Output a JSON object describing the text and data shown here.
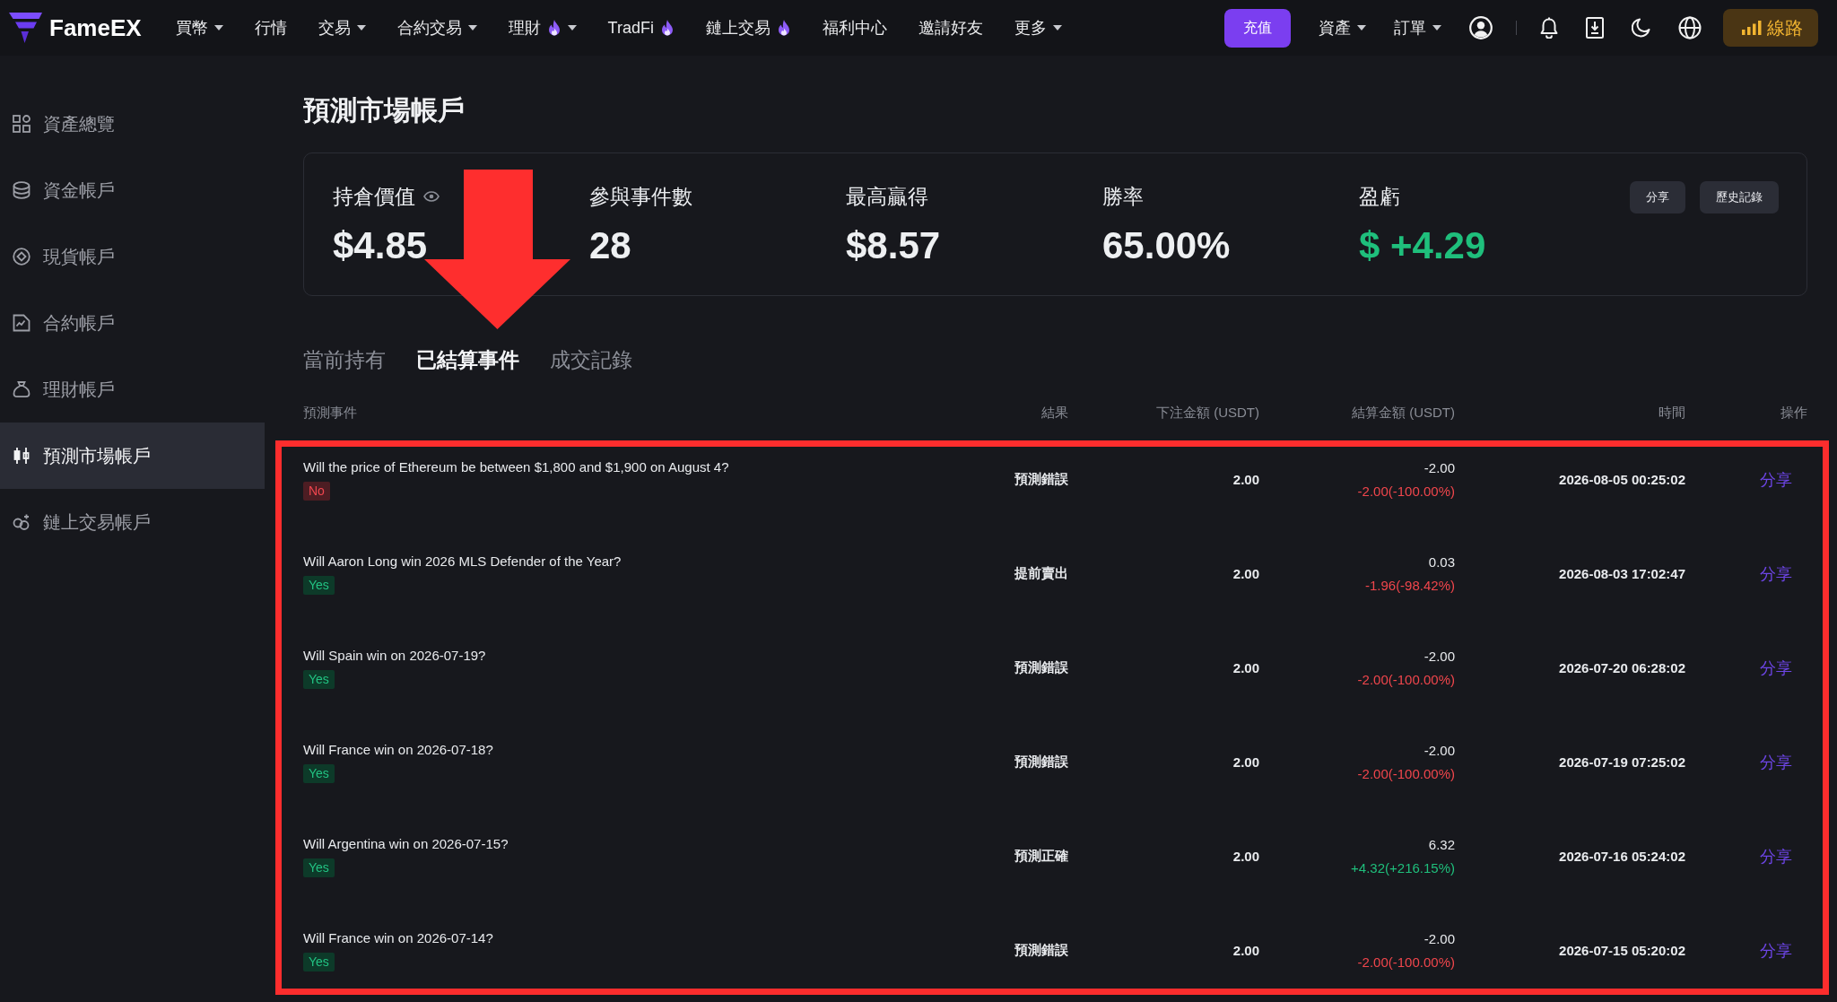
{
  "header": {
    "logo": "FameEX",
    "nav": [
      {
        "label": "買幣",
        "dropdown": true,
        "hot": false
      },
      {
        "label": "行情",
        "dropdown": false,
        "hot": false
      },
      {
        "label": "交易",
        "dropdown": true,
        "hot": false
      },
      {
        "label": "合約交易",
        "dropdown": true,
        "hot": false
      },
      {
        "label": "理財",
        "dropdown": true,
        "hot": true
      },
      {
        "label": "TradFi",
        "dropdown": false,
        "hot": true
      },
      {
        "label": "鏈上交易",
        "dropdown": false,
        "hot": true
      },
      {
        "label": "福利中心",
        "dropdown": false,
        "hot": false
      },
      {
        "label": "邀請好友",
        "dropdown": false,
        "hot": false
      },
      {
        "label": "更多",
        "dropdown": true,
        "hot": false
      }
    ],
    "deposit_button": "充值",
    "menus": [
      {
        "label": "資產",
        "dropdown": true
      },
      {
        "label": "訂單",
        "dropdown": true
      }
    ],
    "route_button": "線路"
  },
  "sidebar": {
    "items": [
      {
        "label": "資產總覽",
        "selected": false
      },
      {
        "label": "資金帳戶",
        "selected": false
      },
      {
        "label": "現貨帳戶",
        "selected": false
      },
      {
        "label": "合約帳戶",
        "selected": false
      },
      {
        "label": "理財帳戶",
        "selected": false
      },
      {
        "label": "預測市場帳戶",
        "selected": true
      },
      {
        "label": "鏈上交易帳戶",
        "selected": false
      }
    ]
  },
  "page_title": "預測市場帳戶",
  "summary": {
    "stats": [
      {
        "label": "持倉價值",
        "value": "$4.85",
        "visibility_toggle": true,
        "positive": false
      },
      {
        "label": "參與事件數",
        "value": "28",
        "visibility_toggle": false,
        "positive": false
      },
      {
        "label": "最高贏得",
        "value": "$8.57",
        "visibility_toggle": false,
        "positive": false
      },
      {
        "label": "勝率",
        "value": "65.00%",
        "visibility_toggle": false,
        "positive": false
      },
      {
        "label": "盈虧",
        "value": "$ +4.29",
        "visibility_toggle": false,
        "positive": true
      }
    ],
    "buttons": [
      "分享",
      "歷史記錄"
    ]
  },
  "tabs": [
    {
      "label": "當前持有",
      "selected": false
    },
    {
      "label": "已結算事件",
      "selected": true
    },
    {
      "label": "成交記錄",
      "selected": false
    }
  ],
  "table": {
    "columns": [
      "預測事件",
      "結果",
      "下注金額 (USDT)",
      "結算金額 (USDT)",
      "時間",
      "操作"
    ],
    "rows": [
      {
        "event": "Will the price of Ethereum be between $1,800 and $1,900 on August 4?",
        "side": {
          "label": "No",
          "positive": false
        },
        "result": "預測錯誤",
        "stake": "2.00",
        "settlement": "-2.00",
        "pnl": {
          "text": "-2.00(-100.00%)",
          "positive": false
        },
        "time": "2026-08-05 00:25:02",
        "action": "分享"
      },
      {
        "event": "Will Aaron Long win 2026 MLS Defender of the Year?",
        "side": {
          "label": "Yes",
          "positive": true
        },
        "result": "提前賣出",
        "stake": "2.00",
        "settlement": "0.03",
        "pnl": {
          "text": "-1.96(-98.42%)",
          "positive": false
        },
        "time": "2026-08-03 17:02:47",
        "action": "分享"
      },
      {
        "event": "Will Spain win on 2026-07-19?",
        "side": {
          "label": "Yes",
          "positive": true
        },
        "result": "預測錯誤",
        "stake": "2.00",
        "settlement": "-2.00",
        "pnl": {
          "text": "-2.00(-100.00%)",
          "positive": false
        },
        "time": "2026-07-20 06:28:02",
        "action": "分享"
      },
      {
        "event": "Will France win on 2026-07-18?",
        "side": {
          "label": "Yes",
          "positive": true
        },
        "result": "預測錯誤",
        "stake": "2.00",
        "settlement": "-2.00",
        "pnl": {
          "text": "-2.00(-100.00%)",
          "positive": false
        },
        "time": "2026-07-19 07:25:02",
        "action": "分享"
      },
      {
        "event": "Will Argentina win on 2026-07-15?",
        "side": {
          "label": "Yes",
          "positive": true
        },
        "result": "預測正確",
        "stake": "2.00",
        "settlement": "6.32",
        "pnl": {
          "text": "+4.32(+216.15%)",
          "positive": true
        },
        "time": "2026-07-16 05:24:02",
        "action": "分享"
      },
      {
        "event": "Will France win on 2026-07-14?",
        "side": {
          "label": "Yes",
          "positive": true
        },
        "result": "預測錯誤",
        "stake": "2.00",
        "settlement": "-2.00",
        "pnl": {
          "text": "-2.00(-100.00%)",
          "positive": false
        },
        "time": "2026-07-15 05:20:02",
        "action": "分享"
      }
    ]
  },
  "annotations": {
    "arrow": true,
    "highlight_frame": true
  }
}
